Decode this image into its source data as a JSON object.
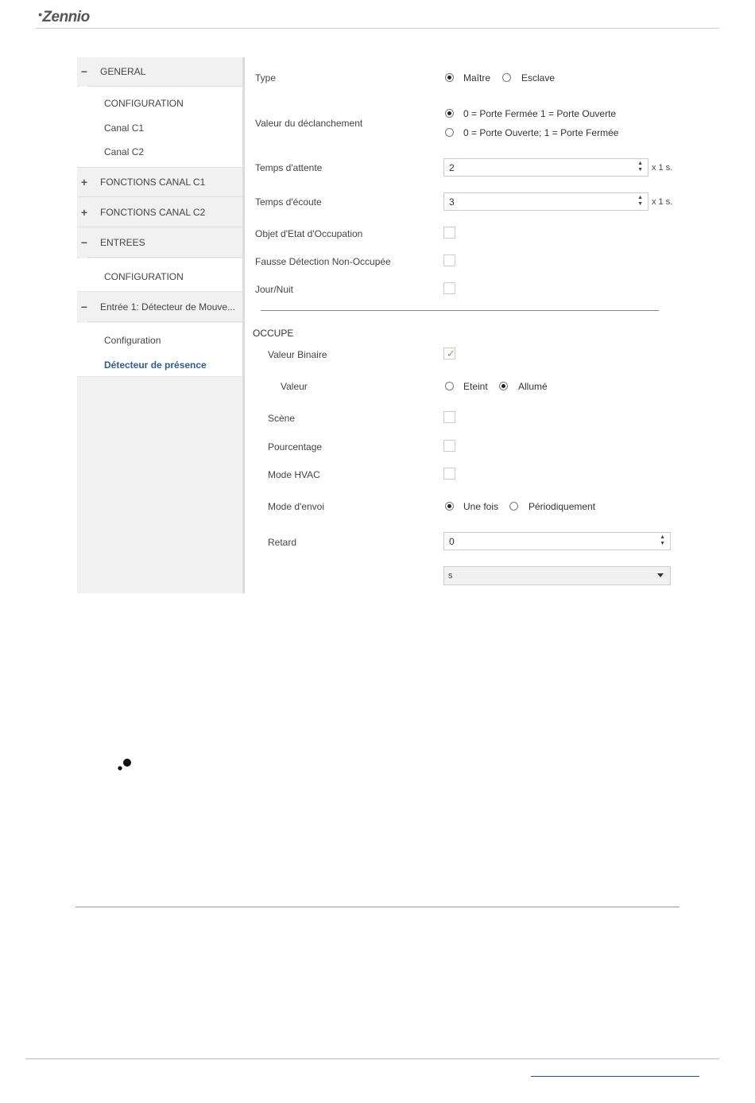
{
  "header": {
    "logo_text": "Zennio",
    "logo_dot": "•"
  },
  "sidebar": {
    "groups": [
      {
        "symbol": "−",
        "label": "GENERAL"
      },
      {
        "symbol": "+",
        "label": "FONCTIONS CANAL C1"
      },
      {
        "symbol": "+",
        "label": "FONCTIONS CANAL C2"
      },
      {
        "symbol": "−",
        "label": "ENTREES"
      },
      {
        "symbol": "−",
        "label": "Entrée 1: Détecteur de Mouve..."
      }
    ],
    "items": [
      {
        "label": "CONFIGURATION"
      },
      {
        "label": "Canal C1"
      },
      {
        "label": "Canal C2"
      },
      {
        "label": "CONFIGURATION"
      },
      {
        "label": "Configuration"
      },
      {
        "label": "Détecteur de présence"
      }
    ]
  },
  "params": {
    "type": {
      "label": "Type",
      "options": [
        "Maître",
        "Esclave"
      ],
      "selected": "Maître"
    },
    "trigger": {
      "label": "Valeur du déclanchement",
      "options": [
        "0 = Porte Fermée 1 = Porte Ouverte",
        "0 = Porte Ouverte; 1 = Porte Fermée"
      ],
      "selected": "0 = Porte Fermée 1 = Porte Ouverte"
    },
    "wait": {
      "label": "Temps d'attente",
      "value": "2",
      "unit": "x 1 s."
    },
    "listen": {
      "label": "Temps d'écoute",
      "value": "3",
      "unit": "x 1 s."
    },
    "occupancy_state": {
      "label": "Objet d'Etat d'Occupation",
      "checked": false
    },
    "false_detection": {
      "label": "Fausse Détection Non-Occupée",
      "checked": false
    },
    "day_night": {
      "label": "Jour/Nuit",
      "checked": false
    }
  },
  "occupe": {
    "section_title": "OCCUPE",
    "binary_value": {
      "label": "Valeur Binaire",
      "checked": true,
      "check_glyph": "✓"
    },
    "value": {
      "label": "Valeur",
      "options": [
        "Eteint",
        "Allumé"
      ],
      "selected": "Allumé"
    },
    "scene": {
      "label": "Scène",
      "checked": false
    },
    "percentage": {
      "label": "Pourcentage",
      "checked": false
    },
    "hvac": {
      "label": "Mode HVAC",
      "checked": false
    },
    "send_mode": {
      "label": "Mode d'envoi",
      "options": [
        "Une fois",
        "Périodiquement"
      ],
      "selected": "Une fois"
    },
    "delay": {
      "label": "Retard",
      "value": "0"
    },
    "delay_unit": {
      "value": "s"
    }
  },
  "spin_arrows": "▲\n▼",
  "colors": {
    "active_link": "#2e5c8f",
    "check": "#6aa84f",
    "footer_link": "#1a47c9"
  }
}
